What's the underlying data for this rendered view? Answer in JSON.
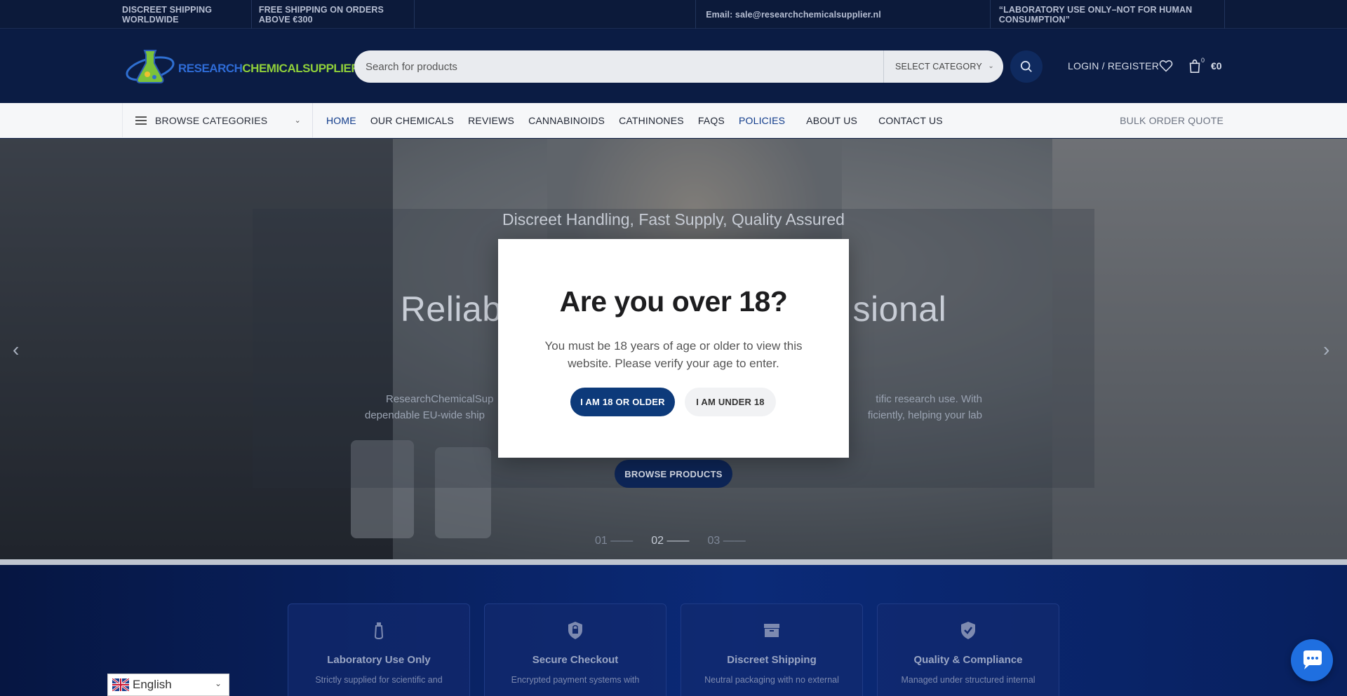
{
  "topbar": {
    "shipping": "DISCREET SHIPPING WORLDWIDE",
    "free_shipping": "FREE SHIPPING ON ORDERS ABOVE €300",
    "email": "Email: sale@researchchemicalsupplier.nl",
    "notice": "“LABORATORY USE ONLY–NOT FOR HUMAN CONSUMPTION”"
  },
  "header": {
    "logo_part1": "RESEARCH",
    "logo_part2": "CHEMICALSUPPLIER",
    "search_placeholder": "Search for products",
    "category_label": "SELECT CATEGORY",
    "login": "LOGIN / REGISTER",
    "cart_count": "0",
    "cart_total": "€0"
  },
  "nav": {
    "browse": "BROWSE CATEGORIES",
    "items": [
      "HOME",
      "OUR CHEMICALS",
      "REVIEWS",
      "CANNABINOIDS",
      "CATHINONES",
      "FAQS",
      "POLICIES",
      "ABOUT US",
      "CONTACT US"
    ],
    "bulk": "BULK ORDER QUOTE"
  },
  "hero": {
    "subtitle": "Discreet Handling, Fast Supply, Quality Assured",
    "heading_left": "Reliab",
    "heading_right": "sional",
    "para_line1_left": "ResearchChemicalSup",
    "para_line1_right": "tific research use. With",
    "para_line2_left": "dependable EU-wide ship",
    "para_line2_right": "ficiently, helping your lab",
    "cta": "BROWSE PRODUCTS",
    "dots": [
      "01 ——",
      "02 ——",
      "03 ——"
    ],
    "active_dot": 1
  },
  "features": [
    {
      "title": "Laboratory Use Only",
      "desc": "Strictly supplied for scientific and",
      "icon": "flask-icon"
    },
    {
      "title": "Secure Checkout",
      "desc": "Encrypted payment systems with",
      "icon": "lock-icon"
    },
    {
      "title": "Discreet Shipping",
      "desc": "Neutral packaging with no external",
      "icon": "box-icon"
    },
    {
      "title": "Quality & Compliance",
      "desc": "Managed under structured internal",
      "icon": "shield-check-icon"
    }
  ],
  "modal": {
    "title": "Are you over 18?",
    "message": "You must be 18 years of age or older to view this website. Please verify your age to enter.",
    "confirm": "I AM 18 OR OLDER",
    "deny": "I AM UNDER 18"
  },
  "language": {
    "selected": "English"
  },
  "colors": {
    "brand_navy": "#0b1c44",
    "accent_blue": "#0d3a7a",
    "chat_blue": "#1f6fe0"
  }
}
